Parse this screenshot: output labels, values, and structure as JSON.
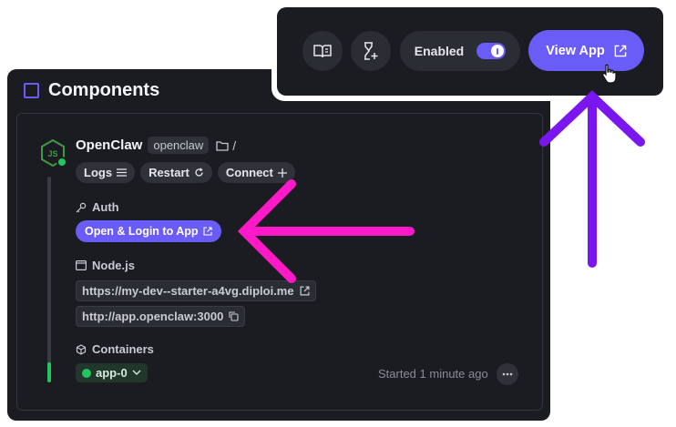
{
  "panel": {
    "title": "Components"
  },
  "component": {
    "name": "OpenClaw",
    "tag": "openclaw",
    "path_sep": "/",
    "buttons": {
      "logs": "Logs",
      "restart": "Restart",
      "connect": "Connect"
    },
    "auth": {
      "label": "Auth",
      "open_login": "Open & Login to App"
    },
    "runtime": {
      "label": "Node.js",
      "public_url": "https://my-dev--starter-a4vg.diploi.me",
      "internal_url": "http://app.openclaw:3000"
    },
    "containers": {
      "label": "Containers",
      "name": "app-0",
      "status_color": "#22c55e",
      "started": "Started 1 minute ago"
    }
  },
  "toolbar": {
    "enabled_label": "Enabled",
    "enabled": true,
    "view_app": "View App"
  },
  "colors": {
    "accent": "#6a5cf6",
    "arrow_magenta": "#ff19c8",
    "arrow_purple": "#7a16f0"
  }
}
